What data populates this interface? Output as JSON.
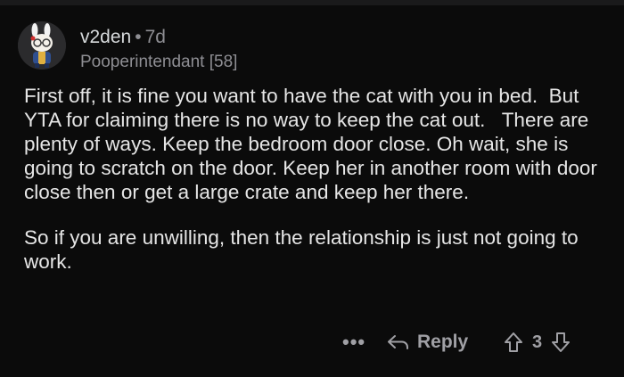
{
  "comment": {
    "username": "v2den",
    "separator": "•",
    "age": "7d",
    "flair": "Pooperintendant [58]",
    "paragraphs": [
      "First off, it is fine you want to have the cat with you in bed.  But YTA for claiming there is no way to keep the cat out.   There are plenty of ways. Keep the bedroom door close. Oh wait, she is going to scratch on the door. Keep her in another room with door close then or get a large crate and keep her there.",
      "So if you are unwilling, then the relationship is just not going to work."
    ],
    "actions": {
      "more_label": "•••",
      "reply_label": "Reply",
      "vote_count": "3"
    }
  },
  "icons": {
    "avatar": "avatar-bunny-icon",
    "reply": "reply-arrow-icon",
    "upvote": "upvote-arrow-icon",
    "downvote": "downvote-arrow-icon"
  },
  "colors": {
    "background": "#0b0b0b",
    "text": "#e6e6e6",
    "meta": "#8e8e93"
  }
}
